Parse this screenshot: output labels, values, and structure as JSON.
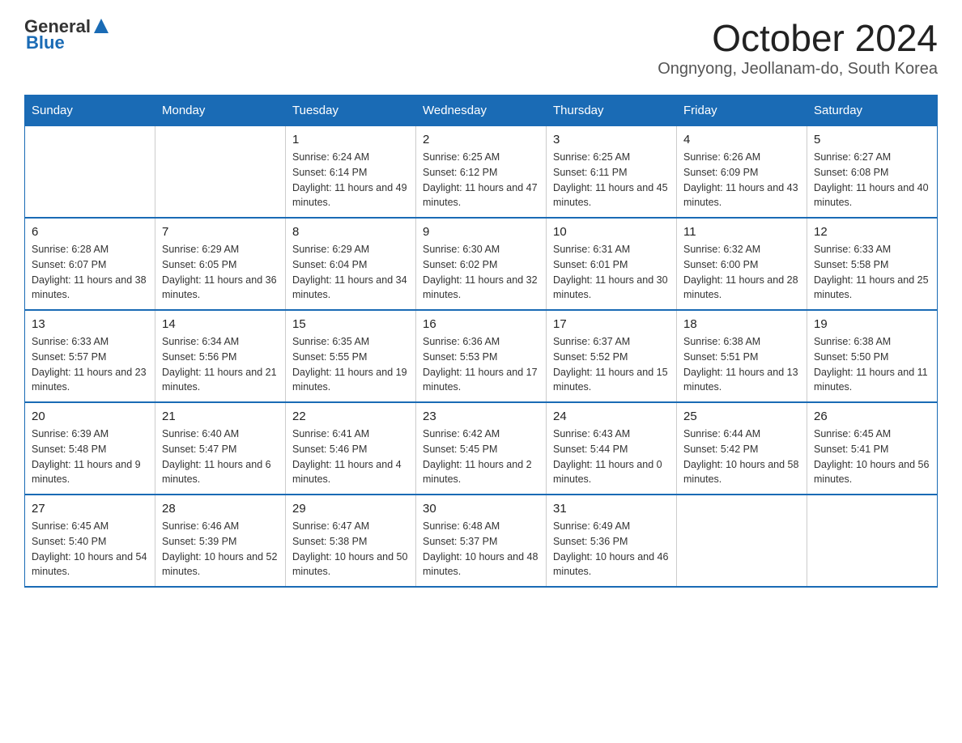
{
  "header": {
    "logo_general": "General",
    "logo_blue": "Blue",
    "month_year": "October 2024",
    "location": "Ongnyong, Jeollanam-do, South Korea"
  },
  "days_of_week": [
    "Sunday",
    "Monday",
    "Tuesday",
    "Wednesday",
    "Thursday",
    "Friday",
    "Saturday"
  ],
  "weeks": [
    [
      {
        "day": "",
        "sunrise": "",
        "sunset": "",
        "daylight": ""
      },
      {
        "day": "",
        "sunrise": "",
        "sunset": "",
        "daylight": ""
      },
      {
        "day": "1",
        "sunrise": "Sunrise: 6:24 AM",
        "sunset": "Sunset: 6:14 PM",
        "daylight": "Daylight: 11 hours and 49 minutes."
      },
      {
        "day": "2",
        "sunrise": "Sunrise: 6:25 AM",
        "sunset": "Sunset: 6:12 PM",
        "daylight": "Daylight: 11 hours and 47 minutes."
      },
      {
        "day": "3",
        "sunrise": "Sunrise: 6:25 AM",
        "sunset": "Sunset: 6:11 PM",
        "daylight": "Daylight: 11 hours and 45 minutes."
      },
      {
        "day": "4",
        "sunrise": "Sunrise: 6:26 AM",
        "sunset": "Sunset: 6:09 PM",
        "daylight": "Daylight: 11 hours and 43 minutes."
      },
      {
        "day": "5",
        "sunrise": "Sunrise: 6:27 AM",
        "sunset": "Sunset: 6:08 PM",
        "daylight": "Daylight: 11 hours and 40 minutes."
      }
    ],
    [
      {
        "day": "6",
        "sunrise": "Sunrise: 6:28 AM",
        "sunset": "Sunset: 6:07 PM",
        "daylight": "Daylight: 11 hours and 38 minutes."
      },
      {
        "day": "7",
        "sunrise": "Sunrise: 6:29 AM",
        "sunset": "Sunset: 6:05 PM",
        "daylight": "Daylight: 11 hours and 36 minutes."
      },
      {
        "day": "8",
        "sunrise": "Sunrise: 6:29 AM",
        "sunset": "Sunset: 6:04 PM",
        "daylight": "Daylight: 11 hours and 34 minutes."
      },
      {
        "day": "9",
        "sunrise": "Sunrise: 6:30 AM",
        "sunset": "Sunset: 6:02 PM",
        "daylight": "Daylight: 11 hours and 32 minutes."
      },
      {
        "day": "10",
        "sunrise": "Sunrise: 6:31 AM",
        "sunset": "Sunset: 6:01 PM",
        "daylight": "Daylight: 11 hours and 30 minutes."
      },
      {
        "day": "11",
        "sunrise": "Sunrise: 6:32 AM",
        "sunset": "Sunset: 6:00 PM",
        "daylight": "Daylight: 11 hours and 28 minutes."
      },
      {
        "day": "12",
        "sunrise": "Sunrise: 6:33 AM",
        "sunset": "Sunset: 5:58 PM",
        "daylight": "Daylight: 11 hours and 25 minutes."
      }
    ],
    [
      {
        "day": "13",
        "sunrise": "Sunrise: 6:33 AM",
        "sunset": "Sunset: 5:57 PM",
        "daylight": "Daylight: 11 hours and 23 minutes."
      },
      {
        "day": "14",
        "sunrise": "Sunrise: 6:34 AM",
        "sunset": "Sunset: 5:56 PM",
        "daylight": "Daylight: 11 hours and 21 minutes."
      },
      {
        "day": "15",
        "sunrise": "Sunrise: 6:35 AM",
        "sunset": "Sunset: 5:55 PM",
        "daylight": "Daylight: 11 hours and 19 minutes."
      },
      {
        "day": "16",
        "sunrise": "Sunrise: 6:36 AM",
        "sunset": "Sunset: 5:53 PM",
        "daylight": "Daylight: 11 hours and 17 minutes."
      },
      {
        "day": "17",
        "sunrise": "Sunrise: 6:37 AM",
        "sunset": "Sunset: 5:52 PM",
        "daylight": "Daylight: 11 hours and 15 minutes."
      },
      {
        "day": "18",
        "sunrise": "Sunrise: 6:38 AM",
        "sunset": "Sunset: 5:51 PM",
        "daylight": "Daylight: 11 hours and 13 minutes."
      },
      {
        "day": "19",
        "sunrise": "Sunrise: 6:38 AM",
        "sunset": "Sunset: 5:50 PM",
        "daylight": "Daylight: 11 hours and 11 minutes."
      }
    ],
    [
      {
        "day": "20",
        "sunrise": "Sunrise: 6:39 AM",
        "sunset": "Sunset: 5:48 PM",
        "daylight": "Daylight: 11 hours and 9 minutes."
      },
      {
        "day": "21",
        "sunrise": "Sunrise: 6:40 AM",
        "sunset": "Sunset: 5:47 PM",
        "daylight": "Daylight: 11 hours and 6 minutes."
      },
      {
        "day": "22",
        "sunrise": "Sunrise: 6:41 AM",
        "sunset": "Sunset: 5:46 PM",
        "daylight": "Daylight: 11 hours and 4 minutes."
      },
      {
        "day": "23",
        "sunrise": "Sunrise: 6:42 AM",
        "sunset": "Sunset: 5:45 PM",
        "daylight": "Daylight: 11 hours and 2 minutes."
      },
      {
        "day": "24",
        "sunrise": "Sunrise: 6:43 AM",
        "sunset": "Sunset: 5:44 PM",
        "daylight": "Daylight: 11 hours and 0 minutes."
      },
      {
        "day": "25",
        "sunrise": "Sunrise: 6:44 AM",
        "sunset": "Sunset: 5:42 PM",
        "daylight": "Daylight: 10 hours and 58 minutes."
      },
      {
        "day": "26",
        "sunrise": "Sunrise: 6:45 AM",
        "sunset": "Sunset: 5:41 PM",
        "daylight": "Daylight: 10 hours and 56 minutes."
      }
    ],
    [
      {
        "day": "27",
        "sunrise": "Sunrise: 6:45 AM",
        "sunset": "Sunset: 5:40 PM",
        "daylight": "Daylight: 10 hours and 54 minutes."
      },
      {
        "day": "28",
        "sunrise": "Sunrise: 6:46 AM",
        "sunset": "Sunset: 5:39 PM",
        "daylight": "Daylight: 10 hours and 52 minutes."
      },
      {
        "day": "29",
        "sunrise": "Sunrise: 6:47 AM",
        "sunset": "Sunset: 5:38 PM",
        "daylight": "Daylight: 10 hours and 50 minutes."
      },
      {
        "day": "30",
        "sunrise": "Sunrise: 6:48 AM",
        "sunset": "Sunset: 5:37 PM",
        "daylight": "Daylight: 10 hours and 48 minutes."
      },
      {
        "day": "31",
        "sunrise": "Sunrise: 6:49 AM",
        "sunset": "Sunset: 5:36 PM",
        "daylight": "Daylight: 10 hours and 46 minutes."
      },
      {
        "day": "",
        "sunrise": "",
        "sunset": "",
        "daylight": ""
      },
      {
        "day": "",
        "sunrise": "",
        "sunset": "",
        "daylight": ""
      }
    ]
  ]
}
